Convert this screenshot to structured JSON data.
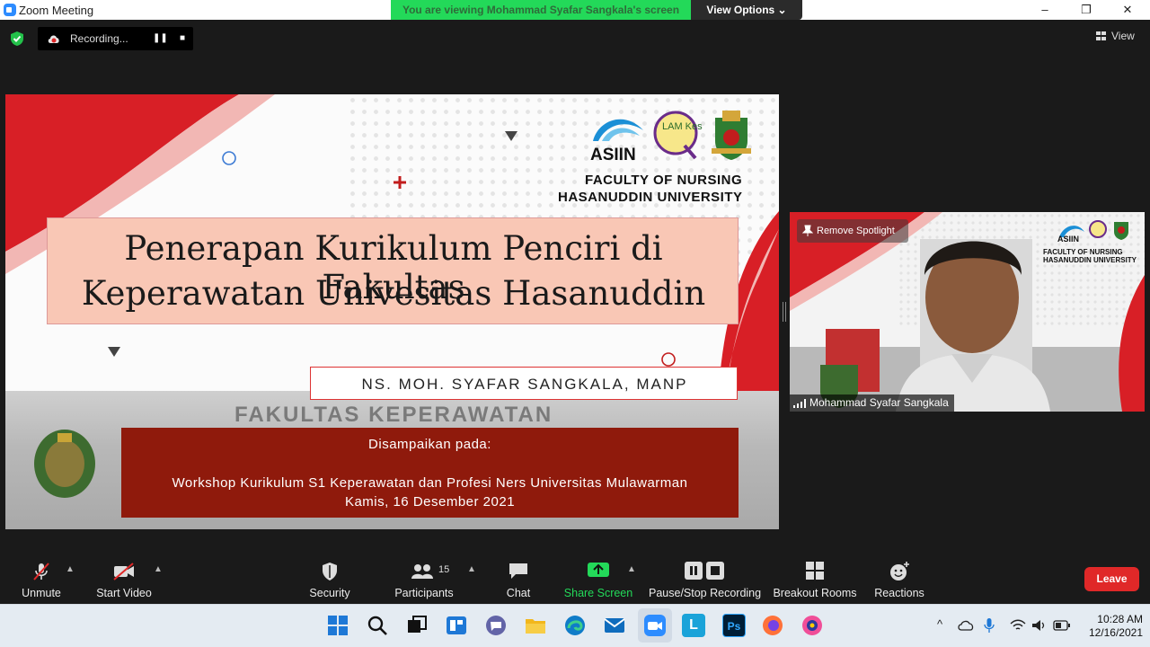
{
  "window": {
    "title": "Zoom Meeting",
    "controls": [
      "–",
      "❐",
      "✕"
    ]
  },
  "banner": {
    "viewing": "You are viewing Mohammad Syafar Sangkala's screen",
    "view_options": "View Options ⌄"
  },
  "top_bar": {
    "recording_label": "Recording...",
    "pause": "❚❚",
    "stop": "■",
    "view_label": "View"
  },
  "slide": {
    "asiin": "ASIIN",
    "faculty_line1": "FACULTY OF NURSING",
    "faculty_line2": "HASANUDDIN UNIVERSITY",
    "title_line1": "Penerapan Kurikulum Penciri di Fakultas",
    "title_line2": "Keperawatan Univesitas Hasanuddin",
    "presenter": "NS. MOH. SYAFAR SANGKALA, MANP",
    "delivered_at": "Disampaikan pada:",
    "event_line1": "Workshop Kurikulum S1 Keperawatan dan Profesi Ners Universitas Mulawarman",
    "event_line2": "Kamis, 16 Desember 2021",
    "building_sign": "FAKULTAS KEPERAWATAN",
    "lam_kes": "LAM Kes"
  },
  "video": {
    "remove_spotlight": "Remove Spotlight",
    "participant_name": "Mohammad Syafar Sangkala",
    "mini_asiin": "ASIIN",
    "mini_faculty_line1": "FACULTY OF NURSING",
    "mini_faculty_line2": "HASANUDDIN UNIVERSITY"
  },
  "toolbar": {
    "unmute": "Unmute",
    "start_video": "Start Video",
    "security": "Security",
    "participants": "Participants",
    "participants_count": "15",
    "chat": "Chat",
    "share_screen": "Share Screen",
    "pause_stop_recording": "Pause/Stop Recording",
    "breakout_rooms": "Breakout Rooms",
    "reactions": "Reactions",
    "leave": "Leave"
  },
  "taskbar": {
    "time": "10:28 AM",
    "date": "12/16/2021",
    "tray_chevron": "^",
    "photoshop": "Ps",
    "lms": "L"
  },
  "colors": {
    "accent_red": "#e02828",
    "share_green": "#23d959",
    "slide_red": "#d81f26",
    "info_bg": "#8f1a0c"
  }
}
